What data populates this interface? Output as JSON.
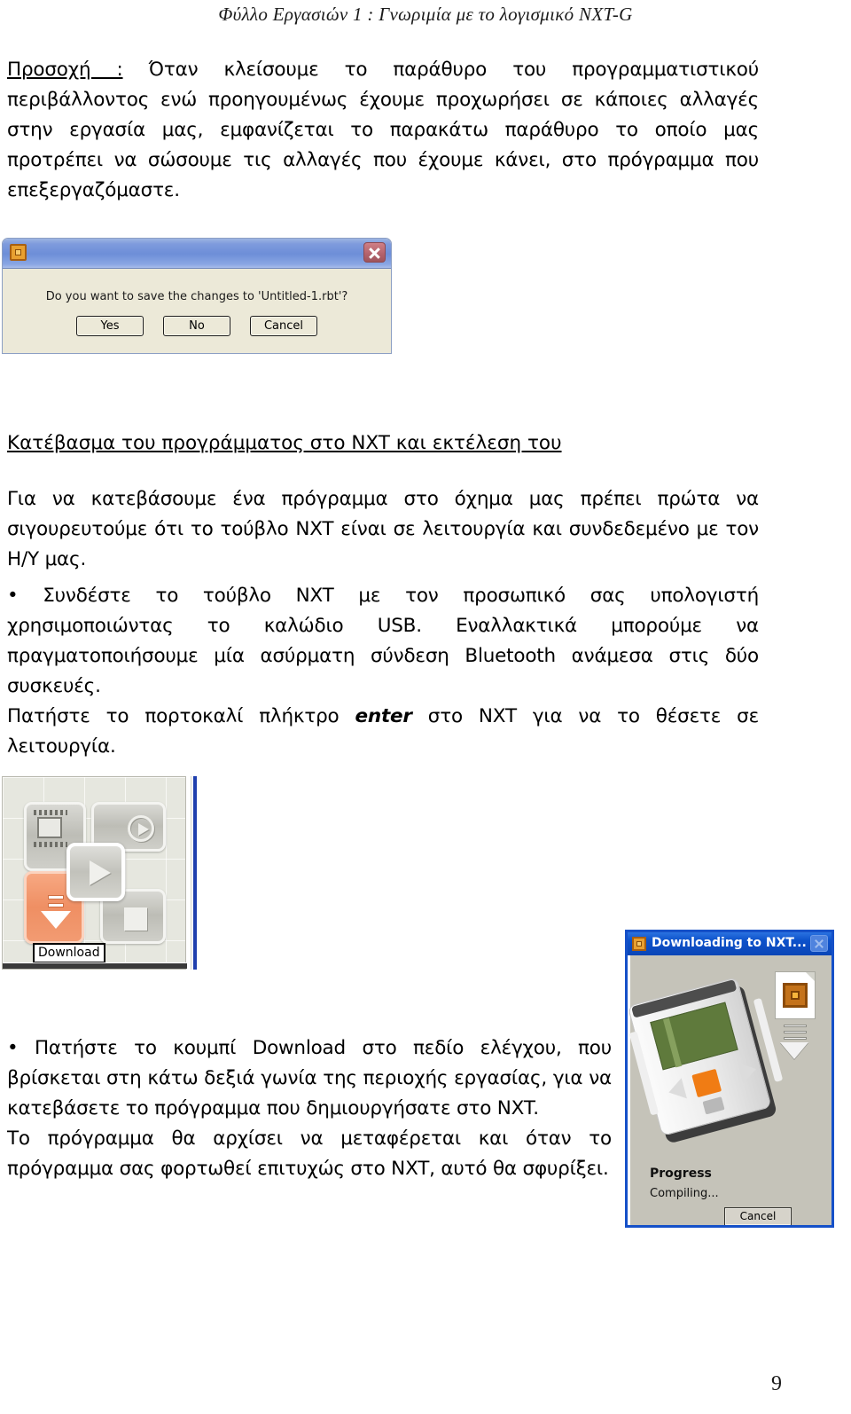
{
  "header": {
    "title": "Φύλλο Εργασιών 1 : Γνωριμία  με το λογισμικό NXT-G"
  },
  "body": {
    "warning_label": "Προσοχή  :",
    "warning_paragraph": " Όταν κλείσουμε το παράθυρο του προγραμματιστικού περιβάλλοντος ενώ προηγουμένως έχουμε προχωρήσει σε κάποιες αλλαγές στην εργασία μας, εμφανίζεται το παρακάτω παράθυρο το οποίο μας προτρέπει να σώσουμε τις αλλαγές που έχουμε κάνει, στο πρόγραμμα που επεξεργαζόμαστε.",
    "section_heading": "Κατέβασμα του προγράμματος στο NXT και εκτέλεση του",
    "paragraph_2": "Για να κατεβάσουμε ένα πρόγραμμα στο όχημα μας πρέπει πρώτα να σιγουρευτούμε ότι το τούβλο NXT είναι σε λειτουργία και συνδεδεμένο με τον Η/Υ μας.",
    "bullet_1_prefix": "• Συνδέστε το τούβλο NXT με τον προσωπικό σας υπολογιστή χρησιμοποιώντας το καλώδιο USB. Εναλλακτικά μπορούμε να πραγματοποιήσουμε μία ασύρματη σύνδεση Bluetooth ανάμεσα στις δύο συσκευές.",
    "paragraph_3_before": "Πατήστε το πορτοκαλί πλήκτρο ",
    "paragraph_3_emph": "enter",
    "paragraph_3_after": " στο NXT για να το θέσετε σε λειτουργία.",
    "bullet_2": "• Πατήστε το κουμπί Download στο πεδίο ελέγχου, που βρίσκεται στη κάτω δεξιά γωνία της περιοχής εργασίας, για να κατεβάσετε το πρόγραμμα που δημιουργήσατε στο NXT.",
    "paragraph_4": "Το πρόγραμμα θα αρχίσει να μεταφέρεται και όταν το πρόγραμμα σας φορτωθεί επιτυχώς στο NXT, αυτό θα σφυρίξει."
  },
  "save_dialog": {
    "icon": "nxt-program-icon",
    "close_icon": "close-icon",
    "message": "Do you want to save the changes to 'Untitled-1.rbt'?",
    "buttons": [
      "Yes",
      "No",
      "Cancel"
    ]
  },
  "controller_panel": {
    "tooltip": "Download",
    "icons": {
      "screen": "nxt-window-icon",
      "play_loop": "run-selected-icon",
      "play": "run-icon",
      "stop": "stop-icon",
      "download": "download-icon"
    },
    "accent_color": "#ef8f63"
  },
  "download_dialog": {
    "title": "Downloading to NXT...",
    "title_icon": "nxt-program-icon",
    "close_icon": "close-icon",
    "progress_label": "Progress",
    "status": "Compiling...",
    "cancel_label": "Cancel",
    "title_bar_color": "#0d52cb",
    "enter_button_color": "#f07c14",
    "lcd_color": "#5f7a3c"
  },
  "footer": {
    "page_number": "9"
  }
}
